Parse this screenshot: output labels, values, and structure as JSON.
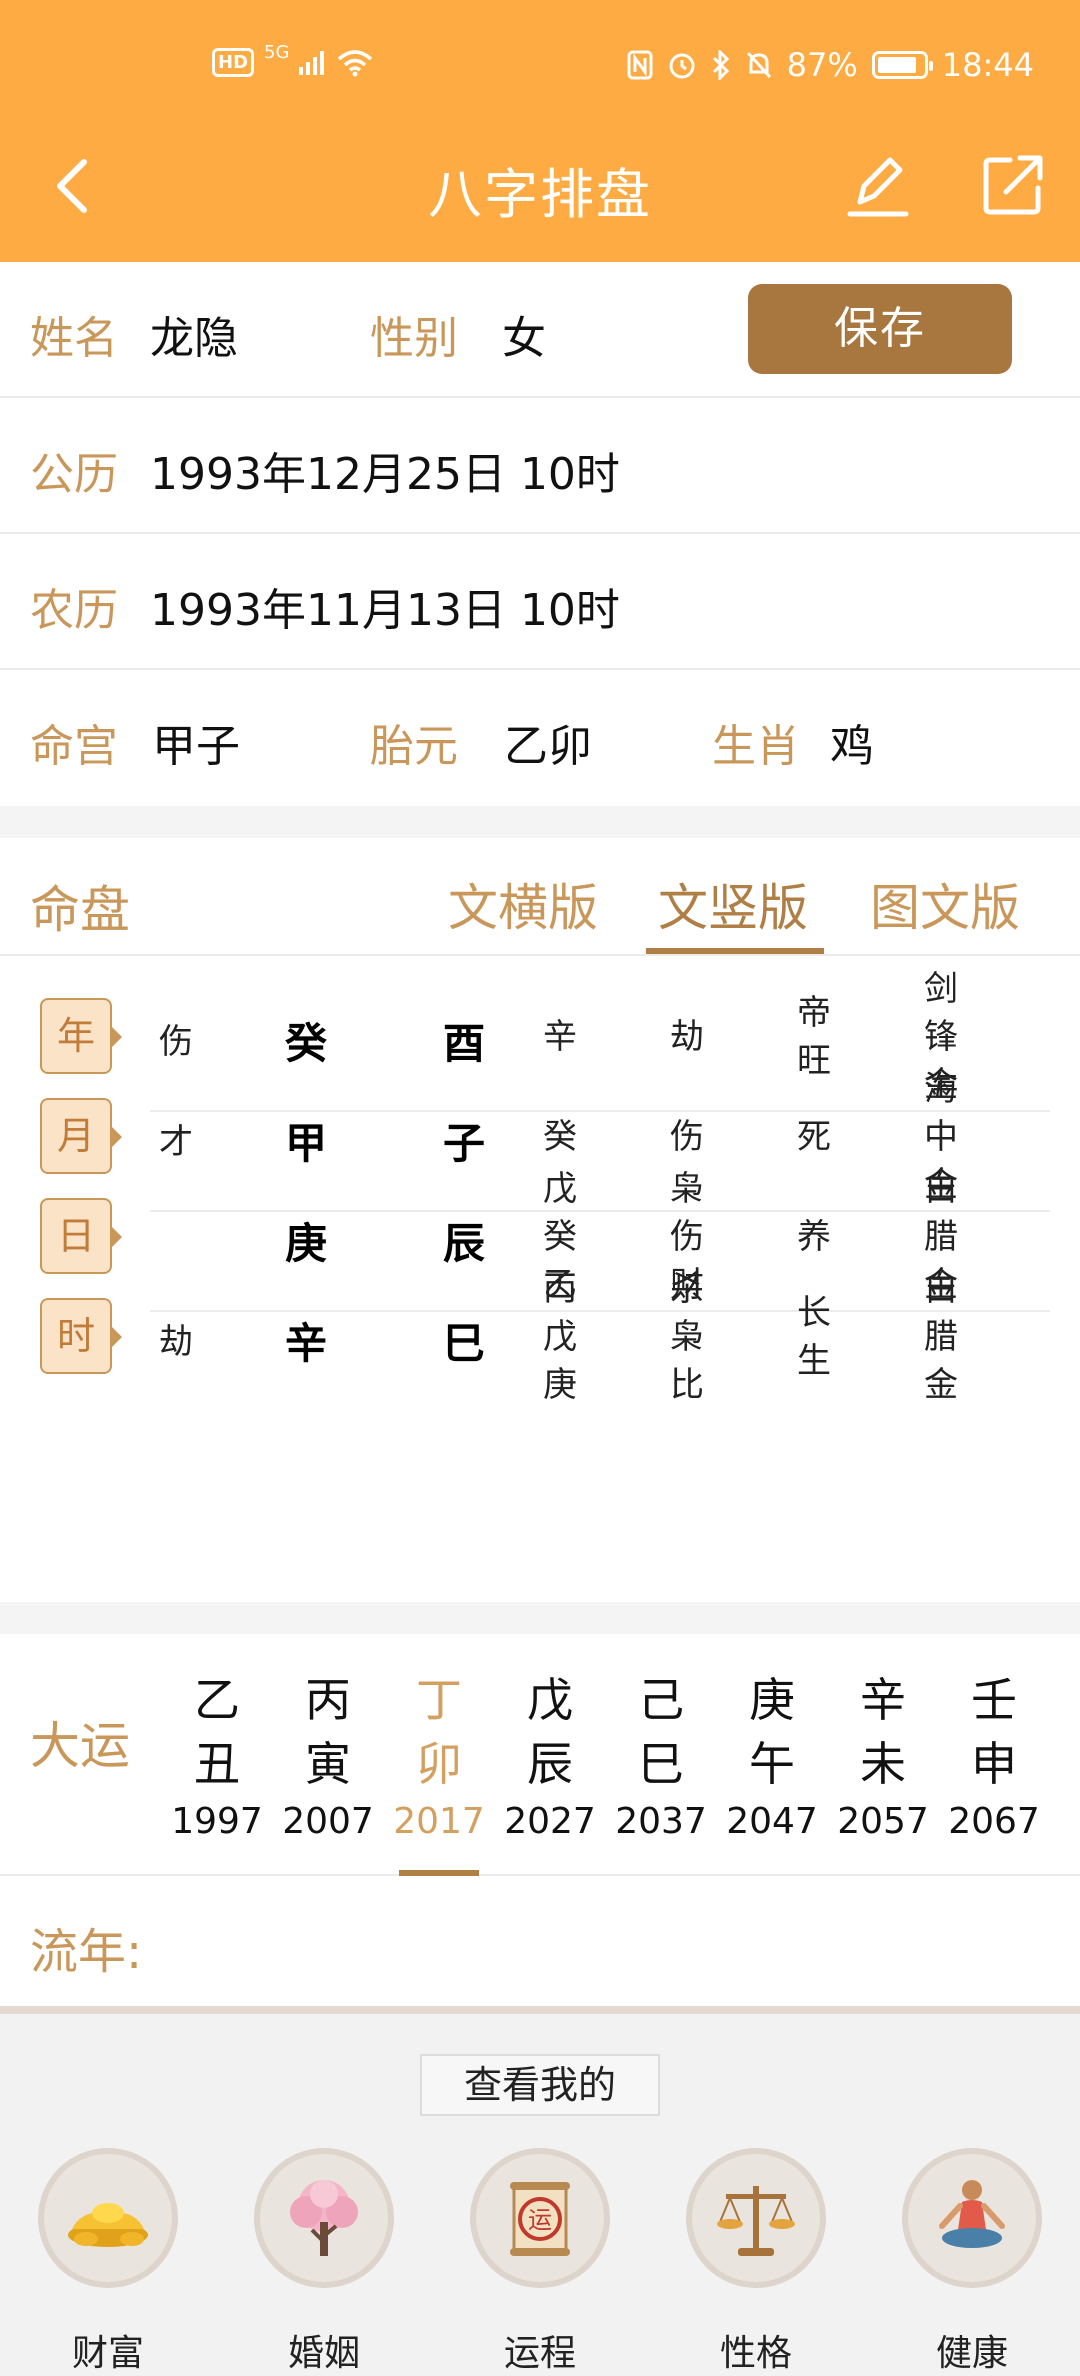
{
  "status_bar": {
    "network": "5G",
    "hd": "HD",
    "battery": "87%",
    "battery_level": 0.87,
    "time": "18:44"
  },
  "header": {
    "title": "八字排盘",
    "back_icon": "chevron-left-icon",
    "edit_icon": "pencil-icon",
    "share_icon": "share-external-icon"
  },
  "profile": {
    "name_label": "姓名",
    "name_value": "龙隐",
    "gender_label": "性别",
    "gender_value": "女",
    "save_label": "保存",
    "solar_label": "公历",
    "solar_value": "1993年12月25日 10时",
    "lunar_label": "农历",
    "lunar_value": "1993年11月13日 10时",
    "minggong_label": "命宫",
    "minggong_value": "甲子",
    "taiyuan_label": "胎元",
    "taiyuan_value": "乙卯",
    "zodiac_label": "生肖",
    "zodiac_value": "鸡"
  },
  "mingpan": {
    "label": "命盘",
    "tabs": [
      "文横版",
      "文竖版",
      "图文版"
    ],
    "active_tab": 1,
    "pillars": [
      {
        "tag": "年",
        "shishen": "伤",
        "stem": "癸",
        "branch": "酉",
        "hidden": "辛",
        "hidden_shishen": "劫",
        "state": "帝旺",
        "nayin": "剑锋金"
      },
      {
        "tag": "月",
        "shishen": "才",
        "stem": "甲",
        "branch": "子",
        "hidden": "癸",
        "hidden_shishen": "伤",
        "state": "死",
        "nayin": "海中金"
      },
      {
        "tag": "日",
        "shishen": "",
        "stem": "庚",
        "branch": "辰",
        "hidden": "戊癸乙",
        "hidden_shishen": "枭伤财",
        "state": "养",
        "nayin": "白腊金"
      },
      {
        "tag": "时",
        "shishen": "劫",
        "stem": "辛",
        "branch": "巳",
        "hidden": "丙戊庚",
        "hidden_shishen": "杀枭比",
        "state": "长生",
        "nayin": "白腊金"
      }
    ]
  },
  "dayun": {
    "label": "大运",
    "active_index": 2,
    "items": [
      {
        "gan": "乙",
        "zhi": "丑",
        "year": "1997"
      },
      {
        "gan": "丙",
        "zhi": "寅",
        "year": "2007"
      },
      {
        "gan": "丁",
        "zhi": "卯",
        "year": "2017"
      },
      {
        "gan": "戊",
        "zhi": "辰",
        "year": "2027"
      },
      {
        "gan": "己",
        "zhi": "巳",
        "year": "2037"
      },
      {
        "gan": "庚",
        "zhi": "午",
        "year": "2047"
      },
      {
        "gan": "辛",
        "zhi": "未",
        "year": "2057"
      },
      {
        "gan": "壬",
        "zhi": "申",
        "year": "2067"
      }
    ]
  },
  "liunian": {
    "label": "流年:"
  },
  "bottom": {
    "cta": "查看我的",
    "features": [
      {
        "name": "财富",
        "icon": "gold-ingot-icon"
      },
      {
        "name": "婚姻",
        "icon": "blossom-tree-icon"
      },
      {
        "name": "运程",
        "icon": "fortune-scroll-icon"
      },
      {
        "name": "性格",
        "icon": "balance-scale-icon"
      },
      {
        "name": "健康",
        "icon": "meditation-icon"
      }
    ]
  },
  "colors": {
    "header_bg": "#fdab42",
    "label": "#c9975a",
    "save_button": "#a8773f",
    "active_year": "#d4a060"
  }
}
